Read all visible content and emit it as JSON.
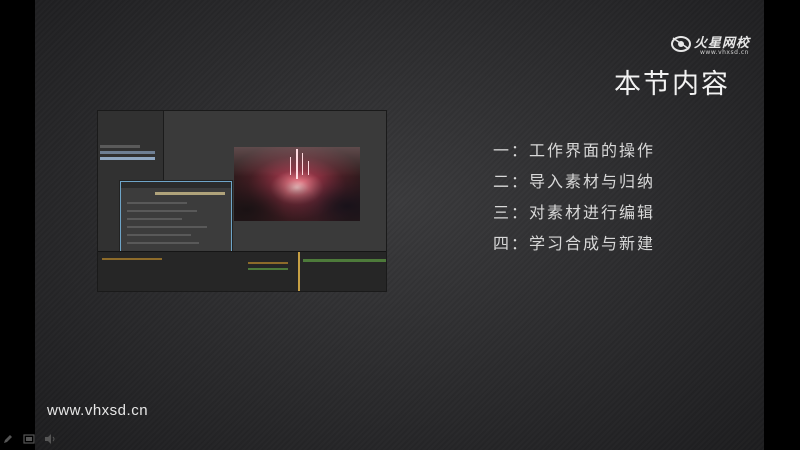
{
  "slide": {
    "title": "本节内容",
    "toc": [
      "一：工作界面的操作",
      "二：导入素材与归纳",
      "三：对素材进行编辑",
      "四：学习合成与新建"
    ],
    "url": "www.vhxsd.cn"
  },
  "logo": {
    "name": "火星网校",
    "sub": "www.vhxsd.cn"
  },
  "colors": {
    "background": "#2a2a2c",
    "text": "#d8d8d8",
    "accent_dialog_border": "#6fa5c8"
  },
  "player_tools": [
    "pencil-icon",
    "slides-icon",
    "speaker-icon"
  ]
}
